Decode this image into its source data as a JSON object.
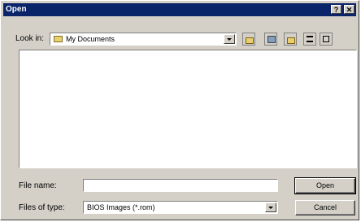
{
  "window": {
    "title": "Open",
    "help_label": "?",
    "close_label": "✕"
  },
  "lookin": {
    "label": "Look in:",
    "value": "My Documents"
  },
  "toolbar": {
    "icons": [
      "up-folder-icon",
      "desktop-icon",
      "new-folder-icon",
      "list-view-icon",
      "details-view-icon"
    ]
  },
  "filename": {
    "label": "File name:",
    "value": ""
  },
  "filetype": {
    "label": "Files of type:",
    "value": "BIOS Images (*.rom)"
  },
  "buttons": {
    "open_label": "Open",
    "cancel_label": "Cancel"
  }
}
